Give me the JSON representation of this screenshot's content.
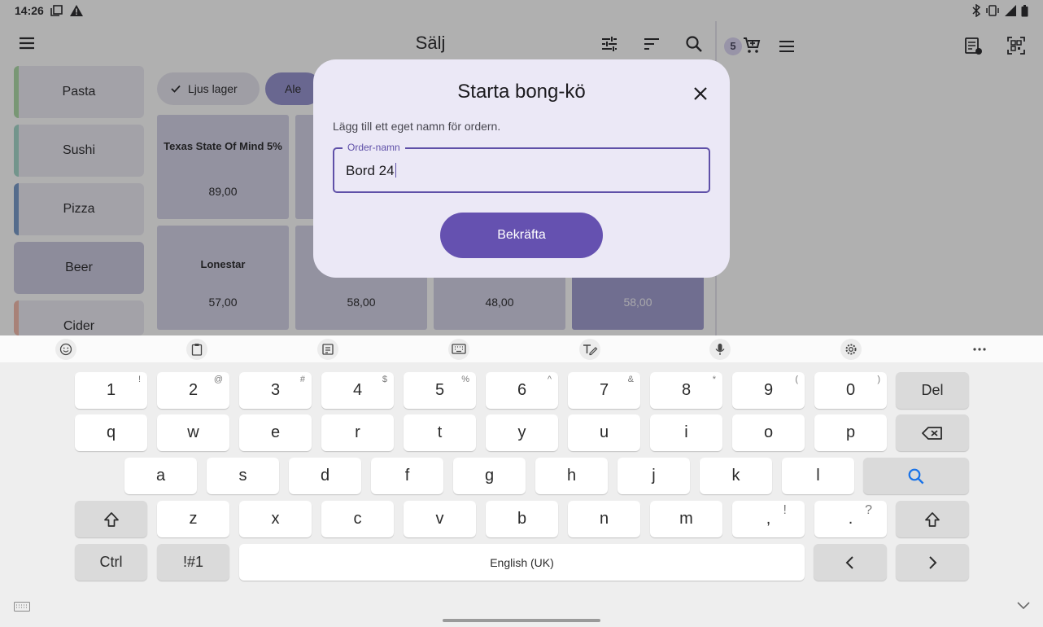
{
  "status_bar": {
    "time": "14:26"
  },
  "app_bar": {
    "title": "Sälj"
  },
  "cart": {
    "count": "5"
  },
  "categories": [
    {
      "label": "Pasta",
      "stripe": "#a9d8a2"
    },
    {
      "label": "Sushi",
      "stripe": "#9fd4c7"
    },
    {
      "label": "Pizza",
      "stripe": "#6f93c6"
    },
    {
      "label": "Beer",
      "stripe": ""
    },
    {
      "label": "Cider",
      "stripe": "#f2b7a6"
    }
  ],
  "filter_chips": [
    {
      "label": "Ljus lager",
      "selected": true
    },
    {
      "label": "Ale",
      "selected": false
    }
  ],
  "products": [
    {
      "name": "Texas State Of Mind 5%",
      "price": "89,00"
    },
    {
      "name": "Lonestar",
      "price": "57,00"
    },
    {
      "name": "",
      "price": "58,00"
    },
    {
      "name": "",
      "price": "48,00"
    },
    {
      "name": "",
      "price": "58,00"
    }
  ],
  "dialog": {
    "title": "Starta bong-kö",
    "description": "Lägg till ett eget namn för ordern.",
    "field_label": "Order-namn",
    "field_value": "Bord 24",
    "confirm_label": "Bekräfta"
  },
  "keyboard": {
    "number_row": [
      {
        "key": "1",
        "hint": "!"
      },
      {
        "key": "2",
        "hint": "@"
      },
      {
        "key": "3",
        "hint": "#"
      },
      {
        "key": "4",
        "hint": "$"
      },
      {
        "key": "5",
        "hint": "%"
      },
      {
        "key": "6",
        "hint": "^"
      },
      {
        "key": "7",
        "hint": "&"
      },
      {
        "key": "8",
        "hint": "*"
      },
      {
        "key": "9",
        "hint": "("
      },
      {
        "key": "0",
        "hint": ")"
      }
    ],
    "del_label": "Del",
    "row_q": [
      "q",
      "w",
      "e",
      "r",
      "t",
      "y",
      "u",
      "i",
      "o",
      "p"
    ],
    "row_a": [
      "a",
      "s",
      "d",
      "f",
      "g",
      "h",
      "j",
      "k",
      "l"
    ],
    "row_z": [
      "z",
      "x",
      "c",
      "v",
      "b",
      "n",
      "m"
    ],
    "comma": {
      "key": ",",
      "hint": "!"
    },
    "period": {
      "key": ".",
      "hint": "?"
    },
    "ctrl_label": "Ctrl",
    "symbols_label": "!#1",
    "space_label": "English (UK)",
    "accent_color": "#1a73e8"
  }
}
